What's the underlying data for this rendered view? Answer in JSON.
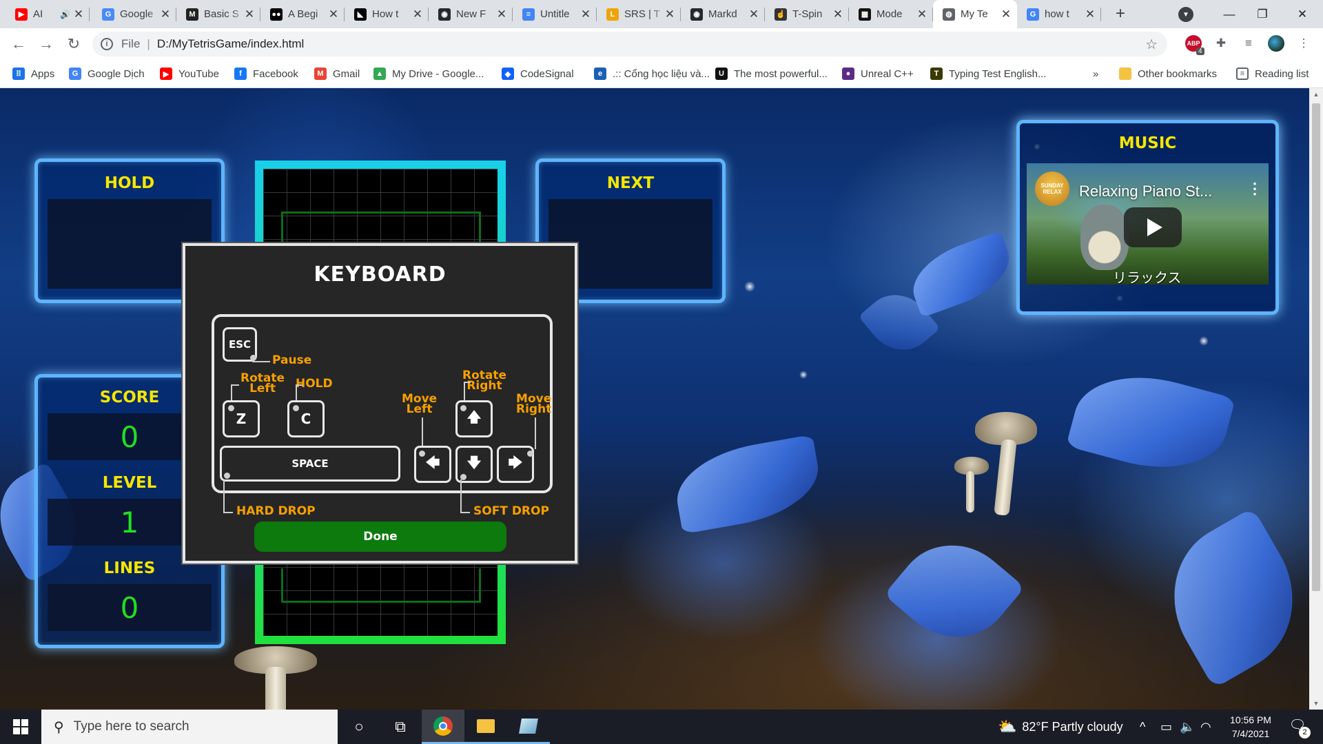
{
  "browser": {
    "tabs": [
      {
        "title": "AI",
        "favicon": "youtube-icon",
        "color": "#ff0000",
        "glyph": "▶",
        "audio": true
      },
      {
        "title": "Google",
        "favicon": "google-docs-icon",
        "color": "#4a8af4",
        "glyph": "G"
      },
      {
        "title": "Basic S",
        "favicon": "medium-icon",
        "color": "#222222",
        "glyph": "M"
      },
      {
        "title": "A Begi",
        "favicon": "dev-icon",
        "color": "#000000",
        "glyph": "●●"
      },
      {
        "title": "How t",
        "favicon": "cat-icon",
        "color": "#000000",
        "glyph": "◣"
      },
      {
        "title": "New F",
        "favicon": "github-icon",
        "color": "#24292e",
        "glyph": "◉"
      },
      {
        "title": "Untitle",
        "favicon": "docs-icon",
        "color": "#4285f4",
        "glyph": "≡"
      },
      {
        "title": "SRS | T",
        "favicon": "bookmark-icon",
        "color": "#f0a40a",
        "glyph": "L"
      },
      {
        "title": "Markd",
        "favicon": "github-icon",
        "color": "#24292e",
        "glyph": "◉"
      },
      {
        "title": "T-Spin",
        "favicon": "pointer-icon",
        "color": "#333333",
        "glyph": "☝"
      },
      {
        "title": "Mode",
        "favicon": "film-icon",
        "color": "#111111",
        "glyph": "▦"
      },
      {
        "title": "My Te",
        "favicon": "globe-icon",
        "color": "#5f6368",
        "glyph": "◍",
        "active": true
      },
      {
        "title": "how t",
        "favicon": "google-icon",
        "color": "#4285f4",
        "glyph": "G"
      }
    ],
    "new_tab": "+",
    "url_scheme": "File",
    "url": "D:/MyTetrisGame/index.html",
    "abp_count": "4",
    "bookmarks": [
      {
        "label": "Apps",
        "icon": "apps-grid-icon",
        "color": "#1a73e8",
        "glyph": "⠿"
      },
      {
        "label": "Google Dịch",
        "icon": "google-translate-icon",
        "color": "#4285f4",
        "glyph": "G"
      },
      {
        "label": "YouTube",
        "icon": "youtube-icon",
        "color": "#ff0000",
        "glyph": "▶"
      },
      {
        "label": "Facebook",
        "icon": "facebook-icon",
        "color": "#1877f2",
        "glyph": "f"
      },
      {
        "label": "Gmail",
        "icon": "gmail-icon",
        "color": "#ea4335",
        "glyph": "M"
      },
      {
        "label": "My Drive - Google...",
        "icon": "google-drive-icon",
        "color": "#34a853",
        "glyph": "▲"
      },
      {
        "label": "CodeSignal",
        "icon": "codesignal-icon",
        "color": "#1062fb",
        "glyph": "◆"
      },
      {
        "label": ".:: Cổng học liệu và...",
        "icon": "portal-icon",
        "color": "#1a5fb4",
        "glyph": "e"
      },
      {
        "label": "The most powerful...",
        "icon": "unreal-icon",
        "color": "#111111",
        "glyph": "U"
      },
      {
        "label": "Unreal C++",
        "icon": "unreal-cpp-icon",
        "color": "#5b2a86",
        "glyph": "●"
      },
      {
        "label": "Typing Test English...",
        "icon": "typing-test-icon",
        "color": "#3a3a00",
        "glyph": "T"
      }
    ],
    "bookmarks_overflow": "»",
    "other_bookmarks": "Other bookmarks",
    "reading_list": "Reading list"
  },
  "game": {
    "hold_title": "HOLD",
    "next_title": "NEXT",
    "score_title": "SCORE",
    "score": "0",
    "level_title": "LEVEL",
    "level": "1",
    "lines_title": "LINES",
    "lines": "0",
    "music_title": "MUSIC",
    "video_title": "Relaxing Piano St...",
    "video_channel": "SUNDAY RELAX",
    "video_caption": "リラックス"
  },
  "keyboard_modal": {
    "title": "KEYBOARD",
    "keys": {
      "esc": "ESC",
      "z": "Z",
      "c": "C",
      "space": "SPACE",
      "up": "🡅",
      "left": "🡄",
      "down": "🡇",
      "right": "🡆"
    },
    "labels": {
      "pause": "Pause",
      "rotate_left": "Rotate\nLeft",
      "hold": "HOLD",
      "rotate_right": "Rotate\nRight",
      "move_left": "Move\nLeft",
      "move_right": "Move\nRight",
      "hard_drop": "HARD DROP",
      "soft_drop": "SOFT DROP"
    },
    "done_label": "Done"
  },
  "taskbar": {
    "search_placeholder": "Type here to search",
    "weather": "82°F  Partly cloudy",
    "time": "10:56 PM",
    "date": "7/4/2021",
    "notification_count": "2"
  }
}
